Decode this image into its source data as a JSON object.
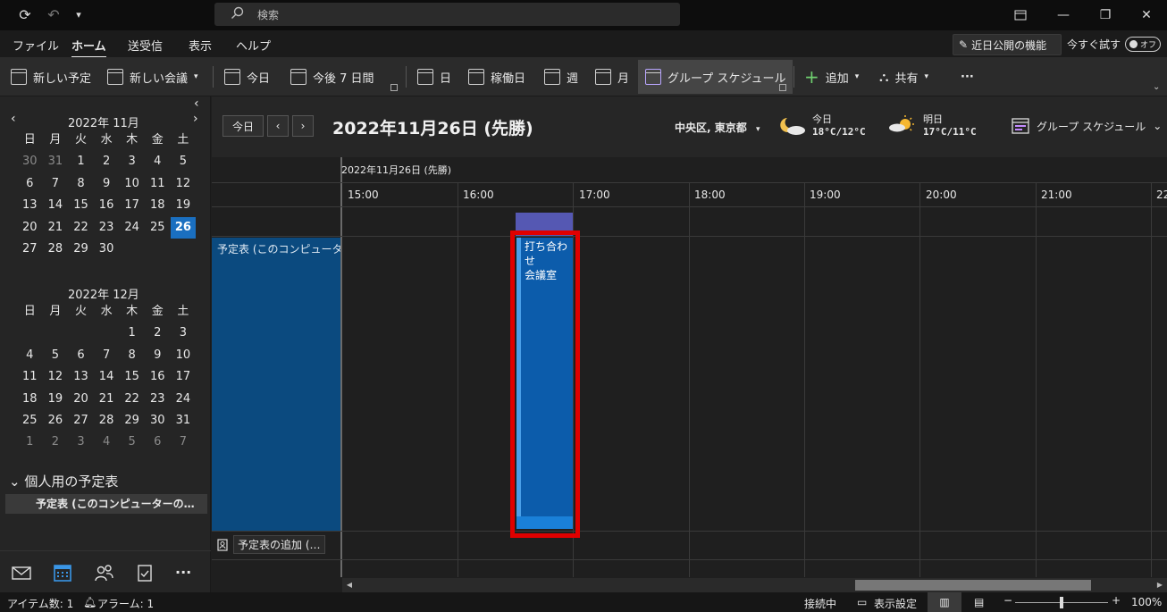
{
  "titlebar": {
    "search_placeholder": "検索"
  },
  "menu": {
    "tabs": [
      "ファイル",
      "ホーム",
      "送受信",
      "表示",
      "ヘルプ"
    ],
    "active_tab": "ホーム",
    "coming_soon": "近日公開の機能",
    "try_now": "今すぐ試す",
    "toggle_label": "オフ"
  },
  "ribbon": {
    "new_appointment": "新しい予定",
    "new_meeting": "新しい会議",
    "today": "今日",
    "next7": "今後 7 日間",
    "day": "日",
    "workweek": "稼働日",
    "week": "週",
    "month": "月",
    "group_schedule": "グループ スケジュール",
    "add": "追加",
    "share": "共有",
    "more": "···"
  },
  "minicals": [
    {
      "title": "2022年 11月",
      "weekdays": [
        "日",
        "月",
        "火",
        "水",
        "木",
        "金",
        "土"
      ],
      "days": [
        "30",
        "31",
        "1",
        "2",
        "3",
        "4",
        "5",
        "6",
        "7",
        "8",
        "9",
        "10",
        "11",
        "12",
        "13",
        "14",
        "15",
        "16",
        "17",
        "18",
        "19",
        "20",
        "21",
        "22",
        "23",
        "24",
        "25",
        "26",
        "27",
        "28",
        "29",
        "30",
        "",
        "",
        ""
      ],
      "dim_count_start": 2,
      "today_index": 27
    },
    {
      "title": "2022年 12月",
      "weekdays": [
        "日",
        "月",
        "火",
        "水",
        "木",
        "金",
        "土"
      ],
      "days": [
        "",
        "",
        "",
        "",
        "1",
        "2",
        "3",
        "4",
        "5",
        "6",
        "7",
        "8",
        "9",
        "10",
        "11",
        "12",
        "13",
        "14",
        "15",
        "16",
        "17",
        "18",
        "19",
        "20",
        "21",
        "22",
        "23",
        "24",
        "25",
        "26",
        "27",
        "28",
        "29",
        "30",
        "31",
        "1",
        "2",
        "3",
        "4",
        "5",
        "6",
        "7"
      ],
      "dim_from_index": 35
    }
  ],
  "folders": {
    "heading": "個人用の予定表",
    "item": "予定表 (このコンピューターの…"
  },
  "header": {
    "today_button": "今日",
    "date_title": "2022年11月26日 (先勝)",
    "location": "中央区, 東京都",
    "weather_today_label": "今日",
    "weather_today_temp": "18°C/12°C",
    "weather_tomorrow_label": "明日",
    "weather_tomorrow_temp": "17°C/11°C",
    "view_select": "グループ スケジュール"
  },
  "grid": {
    "date_row": "2022年11月26日 (先勝)",
    "hours": [
      "15:00",
      "16:00",
      "17:00",
      "18:00",
      "19:00",
      "20:00",
      "21:00",
      "22"
    ],
    "owner_label": "予定表 (このコンピューター",
    "add_calendar": "予定表の追加 (…"
  },
  "event": {
    "title": "打ち合わせ",
    "location": "会議室",
    "colors": {
      "fill": "#0c5cab",
      "busy": "#5558b3",
      "highlight": "#e00000"
    }
  },
  "status": {
    "items": "アイテム数: 1",
    "alarms": "アラーム: 1",
    "connection": "接続中",
    "display_settings": "表示設定",
    "zoom": "100%"
  }
}
